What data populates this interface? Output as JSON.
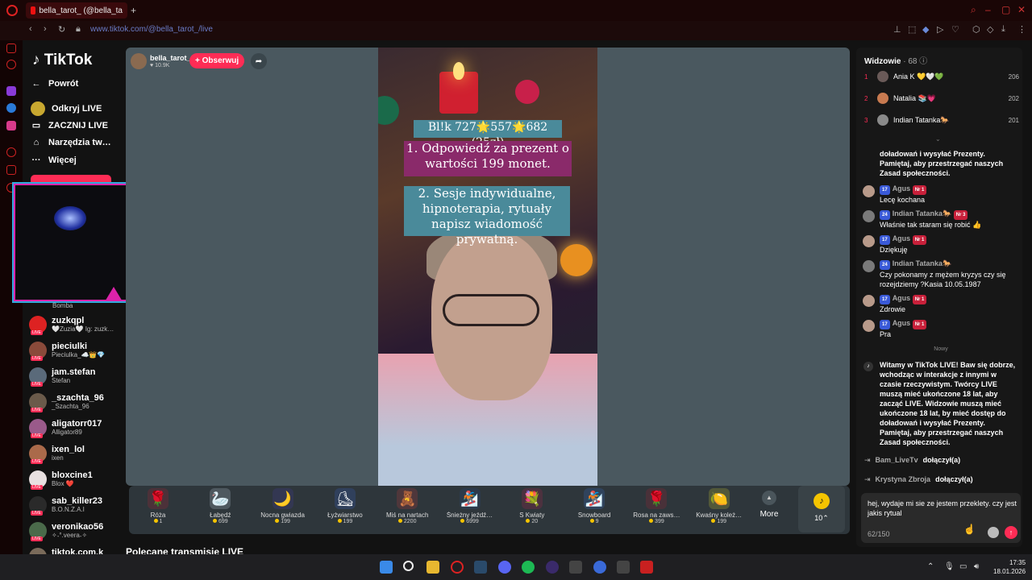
{
  "browser": {
    "tab_title": "bella_tarot_ (@bella_ta",
    "new_tab": "+",
    "address": "www.tiktok.com/@bella_tarot_/live"
  },
  "nav": {
    "logo": "TikTok",
    "back": "Powrót",
    "discover": "Odkryj LIVE",
    "start": "ZACZNIJ LIVE",
    "tools": "Narzędzia tw…",
    "more": "Więcej"
  },
  "channels": [
    {
      "name": "zuzkqpl",
      "sub": "🤍Zuzia🤍 Ig: zuzk…"
    },
    {
      "name": "pieciulki",
      "sub": "Pieciulka_☁️👑💎"
    },
    {
      "name": "jam.stefan",
      "sub": "Stefan"
    },
    {
      "name": "_szachta_96",
      "sub": "_Szachta_96"
    },
    {
      "name": "aligatorr017",
      "sub": "Alligator89"
    },
    {
      "name": "ixen_lol",
      "sub": "ixen"
    },
    {
      "name": "bloxcine1",
      "sub": "Blox ❤️"
    },
    {
      "name": "sab_killer23",
      "sub": "B.O.N.Z.A.I"
    },
    {
      "name": "veronikao56",
      "sub": "✧˖°.veera˖✧"
    },
    {
      "name": "tiktok.com.k",
      "sub": ""
    }
  ],
  "webcam_label": "Bomba",
  "streamer": {
    "name": "bella_tarot_",
    "likes": "10.9K",
    "follow": "+ Obserwuj"
  },
  "overlay": {
    "line1": "Bl!k 727🌟557🌟682 (25zł)",
    "line2": "1. Odpowiedź za prezent o wartości 199 monet.",
    "line3": "2. Sesje indywidualne, hipnoterapia, rytuały napisz wiadomość prywatną."
  },
  "gifts": [
    {
      "name": "Róża",
      "price": "1",
      "icon": "🌹"
    },
    {
      "name": "Łabędź",
      "price": "699",
      "icon": "🦢"
    },
    {
      "name": "Nocna gwiazda",
      "price": "199",
      "icon": "🌙"
    },
    {
      "name": "Łyżwiarstwo",
      "price": "199",
      "icon": "⛸"
    },
    {
      "name": "Miś na nartach",
      "price": "2200",
      "icon": "🧸"
    },
    {
      "name": "Śnieżny jeźdź…",
      "price": "6999",
      "icon": "🏂"
    },
    {
      "name": "S Kwiaty",
      "price": "20",
      "icon": "💐"
    },
    {
      "name": "Snowboard",
      "price": "9",
      "icon": "🏂"
    },
    {
      "name": "Rosa na zaws…",
      "price": "399",
      "icon": "🌹"
    },
    {
      "name": "Kwaśny koleż…",
      "price": "199",
      "icon": "🍋"
    }
  ],
  "more_gifts": "More",
  "coins": "10⌃",
  "recommended": "Polecane transmisje LIVE",
  "chat": {
    "viewers_label": "Widzowie",
    "viewers_count": "· 68",
    "top": [
      {
        "rank": "1",
        "name": "Ania K 💛🤍💚",
        "score": "206"
      },
      {
        "rank": "2",
        "name": "Natalia 📚💗",
        "score": "202"
      },
      {
        "rank": "3",
        "name": "Indian Tatanka🐎",
        "score": "201"
      }
    ],
    "partial": "doładowań i wysyłać Prezenty. Pamiętaj, aby przestrzegać naszych Zasad społeczności.",
    "messages": [
      {
        "lvl": "17",
        "name": "Agus",
        "fan": "Nr 1",
        "text": "Lecę kochana"
      },
      {
        "lvl": "24",
        "name": "Indian Tatanka🐎",
        "fan": "Nr 3",
        "text": "Właśnie tak staram się robić 👍"
      },
      {
        "lvl": "17",
        "name": "Agus",
        "fan": "Nr 1",
        "text": "Dziękuję"
      },
      {
        "lvl": "24",
        "name": "Indian Tatanka🐎",
        "fan": "",
        "text": "Czy pokonamy z mężem kryzys czy się rozejdziemy ?Kasia 10.05.1987"
      },
      {
        "lvl": "17",
        "name": "Agus",
        "fan": "Nr 1",
        "text": "Zdrowie"
      },
      {
        "lvl": "17",
        "name": "Agus",
        "fan": "Nr 1",
        "text": "Pra"
      }
    ],
    "new_label": "Nowy",
    "system": "Witamy w TikTok LIVE! Baw się dobrze, wchodząc w interakcje z innymi w czasie rzeczywistym. Twórcy LIVE muszą mieć ukończone 18 lat, aby zacząć LIVE. Widzowie muszą mieć ukończone 18 lat, by mieć dostęp do doładowań i wysyłać Prezenty. Pamiętaj, aby przestrzegać naszych Zasad społeczności.",
    "joins": [
      {
        "name": "Bam_LiveTv",
        "text": "dołączył(a)"
      },
      {
        "name": "Krystyna Zbroja",
        "text": "dołączył(a)"
      }
    ],
    "input_text": "hej, wydaje mi sie ze jestem przeklety. czy jest jakis rytual",
    "input_count": "62/150"
  },
  "taskbar": {
    "time": "17:35",
    "date": "18.01.2026"
  }
}
